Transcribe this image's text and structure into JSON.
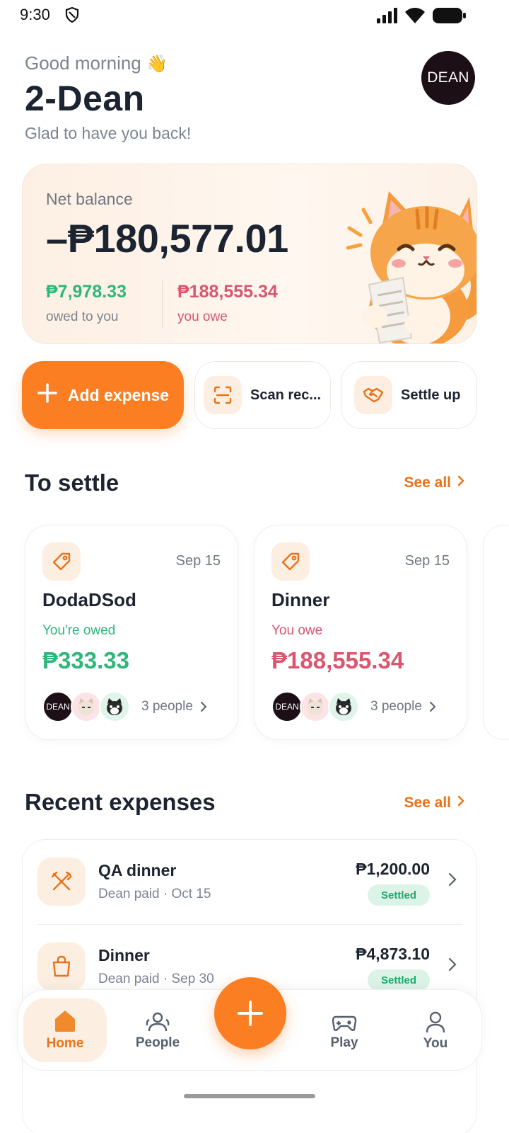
{
  "status_bar": {
    "time": "9:30"
  },
  "header": {
    "greeting": "Good morning",
    "greeting_emoji": "👋",
    "username": "2-Dean",
    "subtitle": "Glad to have you back!",
    "avatar_text": "DEAN"
  },
  "balance": {
    "net_label": "Net balance",
    "net_value": "–₱180,577.01",
    "owed_to_value": "₱7,978.33",
    "owed_to_label": "owed to you",
    "you_owe_value": "₱188,555.34",
    "you_owe_label": "you owe"
  },
  "actions": {
    "add_label": "Add expense",
    "scan_label": "Scan rec...",
    "settle_label": "Settle up"
  },
  "to_settle": {
    "title": "To settle",
    "see_all": "See all",
    "cards": [
      {
        "date": "Sep 15",
        "title": "DodaDSod",
        "status": "You're owed",
        "amount": "₱333.33",
        "people": "3 people",
        "avatar_text": "DEAN"
      },
      {
        "date": "Sep 15",
        "title": "Dinner",
        "status": "You owe",
        "amount": "₱188,555.34",
        "people": "3 people",
        "avatar_text": "DEAN"
      }
    ]
  },
  "recent": {
    "title": "Recent expenses",
    "see_all": "See all",
    "items": [
      {
        "name": "QA dinner",
        "meta": "Dean paid · Oct 15",
        "amount": "₱1,200.00",
        "badge": "Settled",
        "icon": "fork-knife-icon"
      },
      {
        "name": "Dinner",
        "meta": "Dean paid · Sep 30",
        "amount": "₱4,873.10",
        "badge": "Settled",
        "icon": "shopping-bag-icon"
      }
    ]
  },
  "nav": {
    "home": "Home",
    "people": "People",
    "play": "Play",
    "you": "You"
  },
  "colors": {
    "accent": "#fb7f22",
    "positive": "#2fb67a",
    "negative": "#d9566e"
  }
}
